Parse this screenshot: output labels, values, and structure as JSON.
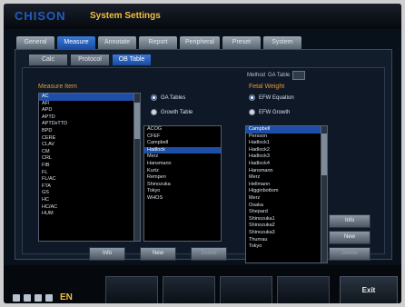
{
  "header": {
    "brand": "CHISON",
    "title": "System Settings"
  },
  "tabs": [
    {
      "label": "General"
    },
    {
      "label": "Measure"
    },
    {
      "label": "Annotate"
    },
    {
      "label": "Report"
    },
    {
      "label": "Peripheral"
    },
    {
      "label": "Preset"
    },
    {
      "label": "System"
    }
  ],
  "subtabs": [
    {
      "label": "Calc"
    },
    {
      "label": "Protocol"
    },
    {
      "label": "OB Table"
    }
  ],
  "method": {
    "label": "Method",
    "value": "GA Table"
  },
  "left": {
    "heading": "Measure Item",
    "items": [
      "AC",
      "AFI",
      "APD",
      "APTD",
      "APTDxTTD",
      "BPD",
      "CERE",
      "CLAV",
      "CM",
      "CRL",
      "FIB",
      "FL",
      "FL/AC",
      "FTA",
      "GS",
      "HC",
      "HC/AC",
      "HUM"
    ]
  },
  "middle": {
    "options": [
      {
        "label": "GA Tables",
        "selected": true
      },
      {
        "label": "Growth Table",
        "selected": false
      }
    ],
    "items": [
      "ACOG",
      "CFEF",
      "Campbell",
      "Hadlock",
      "Merz",
      "Hansmann",
      "Kurtz",
      "Rempen",
      "Shinozuka",
      "Tokyo",
      "WHOS"
    ]
  },
  "right": {
    "heading": "Fetal Weight",
    "options": [
      {
        "label": "EFW Equation",
        "selected": true
      },
      {
        "label": "EFW Growth",
        "selected": false
      }
    ],
    "items": [
      "Campbell",
      "Persson",
      "Hadlock1",
      "Hadlock2",
      "Hadlock3",
      "Hadlock4",
      "Hansmann",
      "Merz",
      "Hellmann",
      "Higginbottom",
      "Merz",
      "Osaka",
      "Shepard",
      "Shinozuka1",
      "Shinozuka2",
      "Shinozuka3",
      "Thurnau",
      "Tokyo"
    ]
  },
  "buttons": {
    "info": "Info",
    "new": "New",
    "delete": "Delete",
    "info2": "Info",
    "new2": "New",
    "delete2": "Delete"
  },
  "footer": {
    "language": "EN",
    "exit": "Exit"
  }
}
